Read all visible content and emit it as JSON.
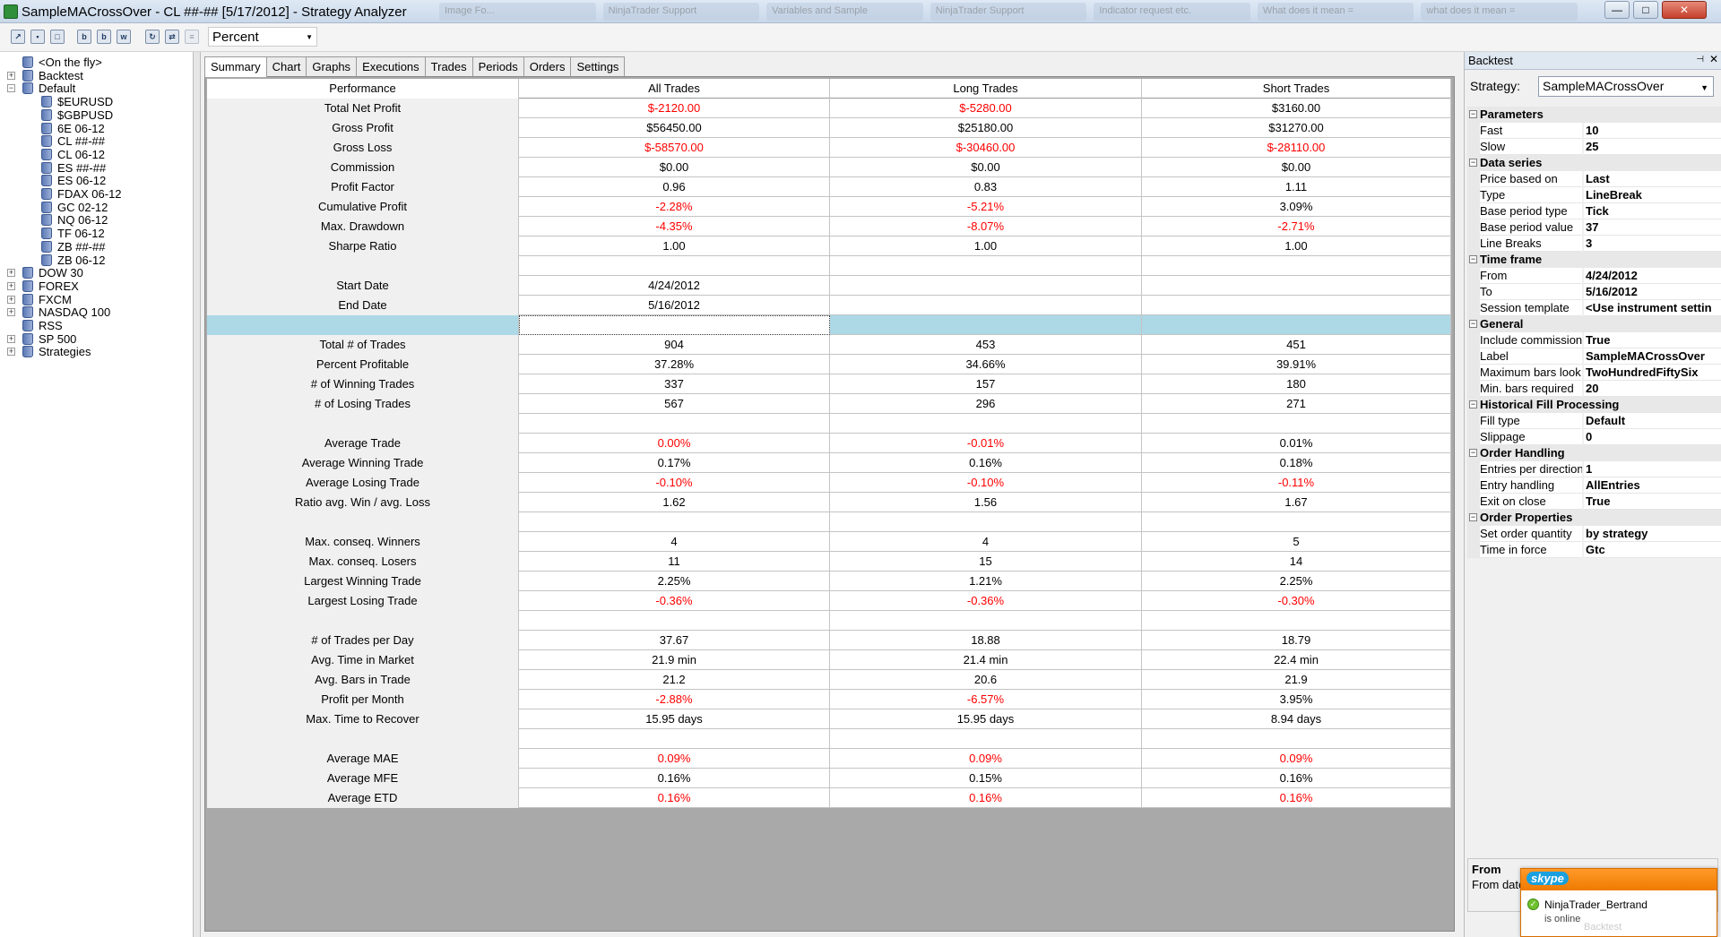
{
  "window": {
    "title": "SampleMACrossOver - CL ##-## [5/17/2012] - Strategy Analyzer",
    "bg_tabs": [
      "Image Fo...",
      "NinjaTrader Support",
      "Variables and Sample",
      "NinjaTrader Support",
      "Indicator request etc.",
      "What does it mean =",
      "what does it mean ="
    ],
    "min_glyph": "—",
    "max_glyph": "□",
    "close_glyph": "✕"
  },
  "toolbar": {
    "display_mode": "Percent",
    "dropdown_arrow": "▼",
    "buttons": [
      "open",
      "save",
      "new",
      "b",
      "b",
      "w",
      "refresh",
      "export",
      "clear"
    ]
  },
  "tree": {
    "expand_glyph": "+",
    "collapse_glyph": "−",
    "items": [
      {
        "label": "<On the fly>",
        "level": 1,
        "expander": ""
      },
      {
        "label": "Backtest",
        "level": 0,
        "expander": "+"
      },
      {
        "label": "Default",
        "level": 0,
        "expander": "−"
      },
      {
        "label": "$EURUSD",
        "level": 2,
        "expander": ""
      },
      {
        "label": "$GBPUSD",
        "level": 2,
        "expander": ""
      },
      {
        "label": "6E 06-12",
        "level": 2,
        "expander": ""
      },
      {
        "label": "CL ##-##",
        "level": 2,
        "expander": ""
      },
      {
        "label": "CL 06-12",
        "level": 2,
        "expander": ""
      },
      {
        "label": "ES ##-##",
        "level": 2,
        "expander": ""
      },
      {
        "label": "ES 06-12",
        "level": 2,
        "expander": ""
      },
      {
        "label": "FDAX 06-12",
        "level": 2,
        "expander": ""
      },
      {
        "label": "GC 02-12",
        "level": 2,
        "expander": ""
      },
      {
        "label": "NQ 06-12",
        "level": 2,
        "expander": ""
      },
      {
        "label": "TF 06-12",
        "level": 2,
        "expander": ""
      },
      {
        "label": "ZB ##-##",
        "level": 2,
        "expander": ""
      },
      {
        "label": "ZB 06-12",
        "level": 2,
        "expander": ""
      },
      {
        "label": "DOW 30",
        "level": 0,
        "expander": "+"
      },
      {
        "label": "FOREX",
        "level": 0,
        "expander": "+"
      },
      {
        "label": "FXCM",
        "level": 0,
        "expander": "+"
      },
      {
        "label": "NASDAQ 100",
        "level": 0,
        "expander": "+"
      },
      {
        "label": "RSS",
        "level": 0,
        "expander": ""
      },
      {
        "label": "SP 500",
        "level": 0,
        "expander": "+"
      },
      {
        "label": "Strategies",
        "level": 0,
        "expander": "+"
      }
    ]
  },
  "tabs": [
    "Summary",
    "Chart",
    "Graphs",
    "Executions",
    "Trades",
    "Periods",
    "Orders",
    "Settings"
  ],
  "active_tab": 0,
  "summary": {
    "columns": [
      "Performance",
      "All Trades",
      "Long Trades",
      "Short Trades"
    ],
    "rows": [
      {
        "label": "Total Net Profit",
        "values": [
          "$-2120.00",
          "$-5280.00",
          "$3160.00"
        ],
        "neg": [
          true,
          true,
          false
        ]
      },
      {
        "label": "Gross Profit",
        "values": [
          "$56450.00",
          "$25180.00",
          "$31270.00"
        ],
        "neg": [
          false,
          false,
          false
        ]
      },
      {
        "label": "Gross Loss",
        "values": [
          "$-58570.00",
          "$-30460.00",
          "$-28110.00"
        ],
        "neg": [
          true,
          true,
          true
        ]
      },
      {
        "label": "Commission",
        "values": [
          "$0.00",
          "$0.00",
          "$0.00"
        ],
        "neg": [
          false,
          false,
          false
        ]
      },
      {
        "label": "Profit Factor",
        "values": [
          "0.96",
          "0.83",
          "1.11"
        ],
        "neg": [
          false,
          false,
          false
        ]
      },
      {
        "label": "Cumulative Profit",
        "values": [
          "-2.28%",
          "-5.21%",
          "3.09%"
        ],
        "neg": [
          true,
          true,
          false
        ]
      },
      {
        "label": "Max. Drawdown",
        "values": [
          "-4.35%",
          "-8.07%",
          "-2.71%"
        ],
        "neg": [
          true,
          true,
          true
        ]
      },
      {
        "label": "Sharpe Ratio",
        "values": [
          "1.00",
          "1.00",
          "1.00"
        ],
        "neg": [
          false,
          false,
          false
        ]
      },
      {
        "label": "",
        "values": [
          "",
          "",
          ""
        ],
        "neg": [
          false,
          false,
          false
        ]
      },
      {
        "label": "Start Date",
        "values": [
          "4/24/2012",
          "",
          ""
        ],
        "neg": [
          false,
          false,
          false
        ]
      },
      {
        "label": "End Date",
        "values": [
          "5/16/2012",
          "",
          ""
        ],
        "neg": [
          false,
          false,
          false
        ]
      },
      {
        "label": "",
        "values": [
          "",
          "",
          ""
        ],
        "neg": [
          false,
          false,
          false
        ],
        "selected": true
      },
      {
        "label": "Total # of Trades",
        "values": [
          "904",
          "453",
          "451"
        ],
        "neg": [
          false,
          false,
          false
        ]
      },
      {
        "label": "Percent Profitable",
        "values": [
          "37.28%",
          "34.66%",
          "39.91%"
        ],
        "neg": [
          false,
          false,
          false
        ]
      },
      {
        "label": "# of Winning Trades",
        "values": [
          "337",
          "157",
          "180"
        ],
        "neg": [
          false,
          false,
          false
        ]
      },
      {
        "label": "# of Losing Trades",
        "values": [
          "567",
          "296",
          "271"
        ],
        "neg": [
          false,
          false,
          false
        ]
      },
      {
        "label": "",
        "values": [
          "",
          "",
          ""
        ],
        "neg": [
          false,
          false,
          false
        ]
      },
      {
        "label": "Average Trade",
        "values": [
          "0.00%",
          "-0.01%",
          "0.01%"
        ],
        "neg": [
          true,
          true,
          false
        ]
      },
      {
        "label": "Average Winning Trade",
        "values": [
          "0.17%",
          "0.16%",
          "0.18%"
        ],
        "neg": [
          false,
          false,
          false
        ]
      },
      {
        "label": "Average Losing Trade",
        "values": [
          "-0.10%",
          "-0.10%",
          "-0.11%"
        ],
        "neg": [
          true,
          true,
          true
        ]
      },
      {
        "label": "Ratio avg. Win / avg. Loss",
        "values": [
          "1.62",
          "1.56",
          "1.67"
        ],
        "neg": [
          false,
          false,
          false
        ]
      },
      {
        "label": "",
        "values": [
          "",
          "",
          ""
        ],
        "neg": [
          false,
          false,
          false
        ]
      },
      {
        "label": "Max. conseq. Winners",
        "values": [
          "4",
          "4",
          "5"
        ],
        "neg": [
          false,
          false,
          false
        ]
      },
      {
        "label": "Max. conseq. Losers",
        "values": [
          "11",
          "15",
          "14"
        ],
        "neg": [
          false,
          false,
          false
        ]
      },
      {
        "label": "Largest Winning Trade",
        "values": [
          "2.25%",
          "1.21%",
          "2.25%"
        ],
        "neg": [
          false,
          false,
          false
        ]
      },
      {
        "label": "Largest Losing Trade",
        "values": [
          "-0.36%",
          "-0.36%",
          "-0.30%"
        ],
        "neg": [
          true,
          true,
          true
        ]
      },
      {
        "label": "",
        "values": [
          "",
          "",
          ""
        ],
        "neg": [
          false,
          false,
          false
        ]
      },
      {
        "label": "# of Trades per Day",
        "values": [
          "37.67",
          "18.88",
          "18.79"
        ],
        "neg": [
          false,
          false,
          false
        ]
      },
      {
        "label": "Avg. Time in Market",
        "values": [
          "21.9 min",
          "21.4 min",
          "22.4 min"
        ],
        "neg": [
          false,
          false,
          false
        ]
      },
      {
        "label": "Avg. Bars in Trade",
        "values": [
          "21.2",
          "20.6",
          "21.9"
        ],
        "neg": [
          false,
          false,
          false
        ]
      },
      {
        "label": "Profit per Month",
        "values": [
          "-2.88%",
          "-6.57%",
          "3.95%"
        ],
        "neg": [
          true,
          true,
          false
        ]
      },
      {
        "label": "Max. Time to Recover",
        "values": [
          "15.95 days",
          "15.95 days",
          "8.94 days"
        ],
        "neg": [
          false,
          false,
          false
        ]
      },
      {
        "label": "",
        "values": [
          "",
          "",
          ""
        ],
        "neg": [
          false,
          false,
          false
        ]
      },
      {
        "label": "Average MAE",
        "values": [
          "0.09%",
          "0.09%",
          "0.09%"
        ],
        "neg": [
          true,
          true,
          true
        ]
      },
      {
        "label": "Average MFE",
        "values": [
          "0.16%",
          "0.15%",
          "0.16%"
        ],
        "neg": [
          false,
          false,
          false
        ]
      },
      {
        "label": "Average ETD",
        "values": [
          "0.16%",
          "0.16%",
          "0.16%"
        ],
        "neg": [
          true,
          true,
          true
        ]
      }
    ]
  },
  "right_panel": {
    "title": "Backtest",
    "pin_glyph": "⊣",
    "close_glyph": "✕",
    "strategy_label": "Strategy:",
    "strategy_value": "SampleMACrossOver",
    "dropdown_arrow": "▼",
    "collapse_glyph": "−",
    "categories": [
      {
        "name": "Parameters",
        "items": [
          [
            "Fast",
            "10"
          ],
          [
            "Slow",
            "25"
          ]
        ]
      },
      {
        "name": "Data series",
        "items": [
          [
            "Price based on",
            "Last"
          ],
          [
            "Type",
            "LineBreak"
          ],
          [
            "Base period type",
            "Tick"
          ],
          [
            "Base period value",
            "37"
          ],
          [
            "Line Breaks",
            "3"
          ]
        ]
      },
      {
        "name": "Time frame",
        "items": [
          [
            "From",
            "4/24/2012"
          ],
          [
            "To",
            "5/16/2012"
          ],
          [
            "Session template",
            "<Use instrument settin"
          ]
        ]
      },
      {
        "name": "General",
        "items": [
          [
            "Include commission",
            "True"
          ],
          [
            "Label",
            "SampleMACrossOver"
          ],
          [
            "Maximum bars look",
            "TwoHundredFiftySix"
          ],
          [
            "Min. bars required",
            "20"
          ]
        ]
      },
      {
        "name": "Historical Fill Processing",
        "items": [
          [
            "Fill type",
            "Default"
          ],
          [
            "Slippage",
            "0"
          ]
        ]
      },
      {
        "name": "Order Handling",
        "items": [
          [
            "Entries per direction",
            "1"
          ],
          [
            "Entry handling",
            "AllEntries"
          ],
          [
            "Exit on close",
            "True"
          ]
        ]
      },
      {
        "name": "Order Properties",
        "items": [
          [
            "Set order quantity",
            "by strategy"
          ],
          [
            "Time in force",
            "Gtc"
          ]
        ]
      }
    ],
    "help_title": "From",
    "help_desc": "From date"
  },
  "skype": {
    "logo": "skype",
    "contact": "NinjaTrader_Bertrand",
    "status": "is online",
    "ghost_text": "Backtest",
    "status_glyph": "✓"
  },
  "colors": {
    "negative": "#ff0000",
    "selected_row": "#add8e6",
    "skype_orange": "#f07a00"
  }
}
